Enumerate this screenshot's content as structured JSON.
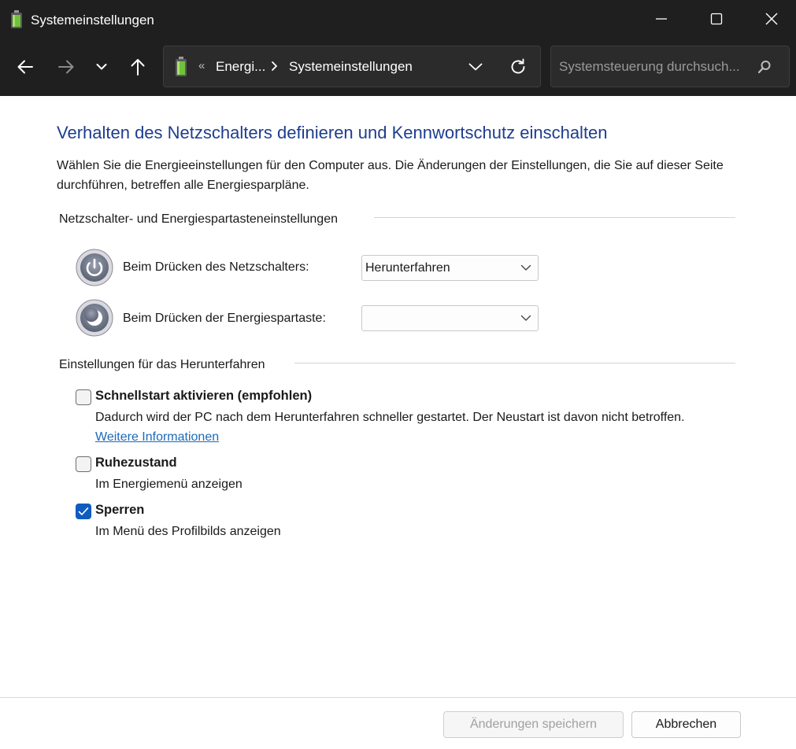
{
  "window": {
    "title": "Systemeinstellungen"
  },
  "navigation": {
    "breadcrumb_overflow": "«",
    "breadcrumb_segment_1": "Energi...",
    "breadcrumb_segment_2": "Systemeinstellungen",
    "search_placeholder": "Systemsteuerung durchsuch..."
  },
  "content": {
    "title": "Verhalten des Netzschalters definieren und Kennwortschutz einschalten",
    "description": "Wählen Sie die Energieeinstellungen für den Computer aus. Die Änderungen der Einstellungen, die Sie auf dieser Seite durchführen, betreffen alle Energiesparpläne.",
    "power_section": {
      "heading": "Netzschalter- und Energiespartasteneinstellungen",
      "rows": [
        {
          "label": "Beim Drücken des Netzschalters:",
          "value": "Herunterfahren"
        },
        {
          "label": "Beim Drücken der Energiespartaste:",
          "value": ""
        }
      ]
    },
    "shutdown_section": {
      "heading": "Einstellungen für das Herunterfahren",
      "options": [
        {
          "title": "Schnellstart aktivieren (empfohlen)",
          "description": "Dadurch wird der PC nach dem Herunterfahren schneller gestartet. Der Neustart ist davon nicht betroffen.",
          "link": "Weitere Informationen",
          "checked": false
        },
        {
          "title": "Ruhezustand",
          "description": "Im Energiemenü anzeigen",
          "checked": false
        },
        {
          "title": "Sperren",
          "description": "Im Menü des Profilbilds anzeigen",
          "checked": true
        }
      ]
    }
  },
  "footer": {
    "save_label": "Änderungen speichern",
    "cancel_label": "Abbrechen"
  },
  "colors": {
    "titlebar_bg": "#1f1f1f",
    "title_text": "#1e3d8f",
    "checkbox_checked": "#0f5cc0",
    "link": "#1a6ab8"
  },
  "icons": [
    "battery-icon",
    "back-arrow-icon",
    "forward-arrow-icon",
    "chevron-down-icon",
    "up-arrow-icon",
    "refresh-icon",
    "search-icon",
    "minimize-icon",
    "maximize-icon",
    "close-icon",
    "power-icon",
    "sleep-icon",
    "checkmark-icon"
  ]
}
